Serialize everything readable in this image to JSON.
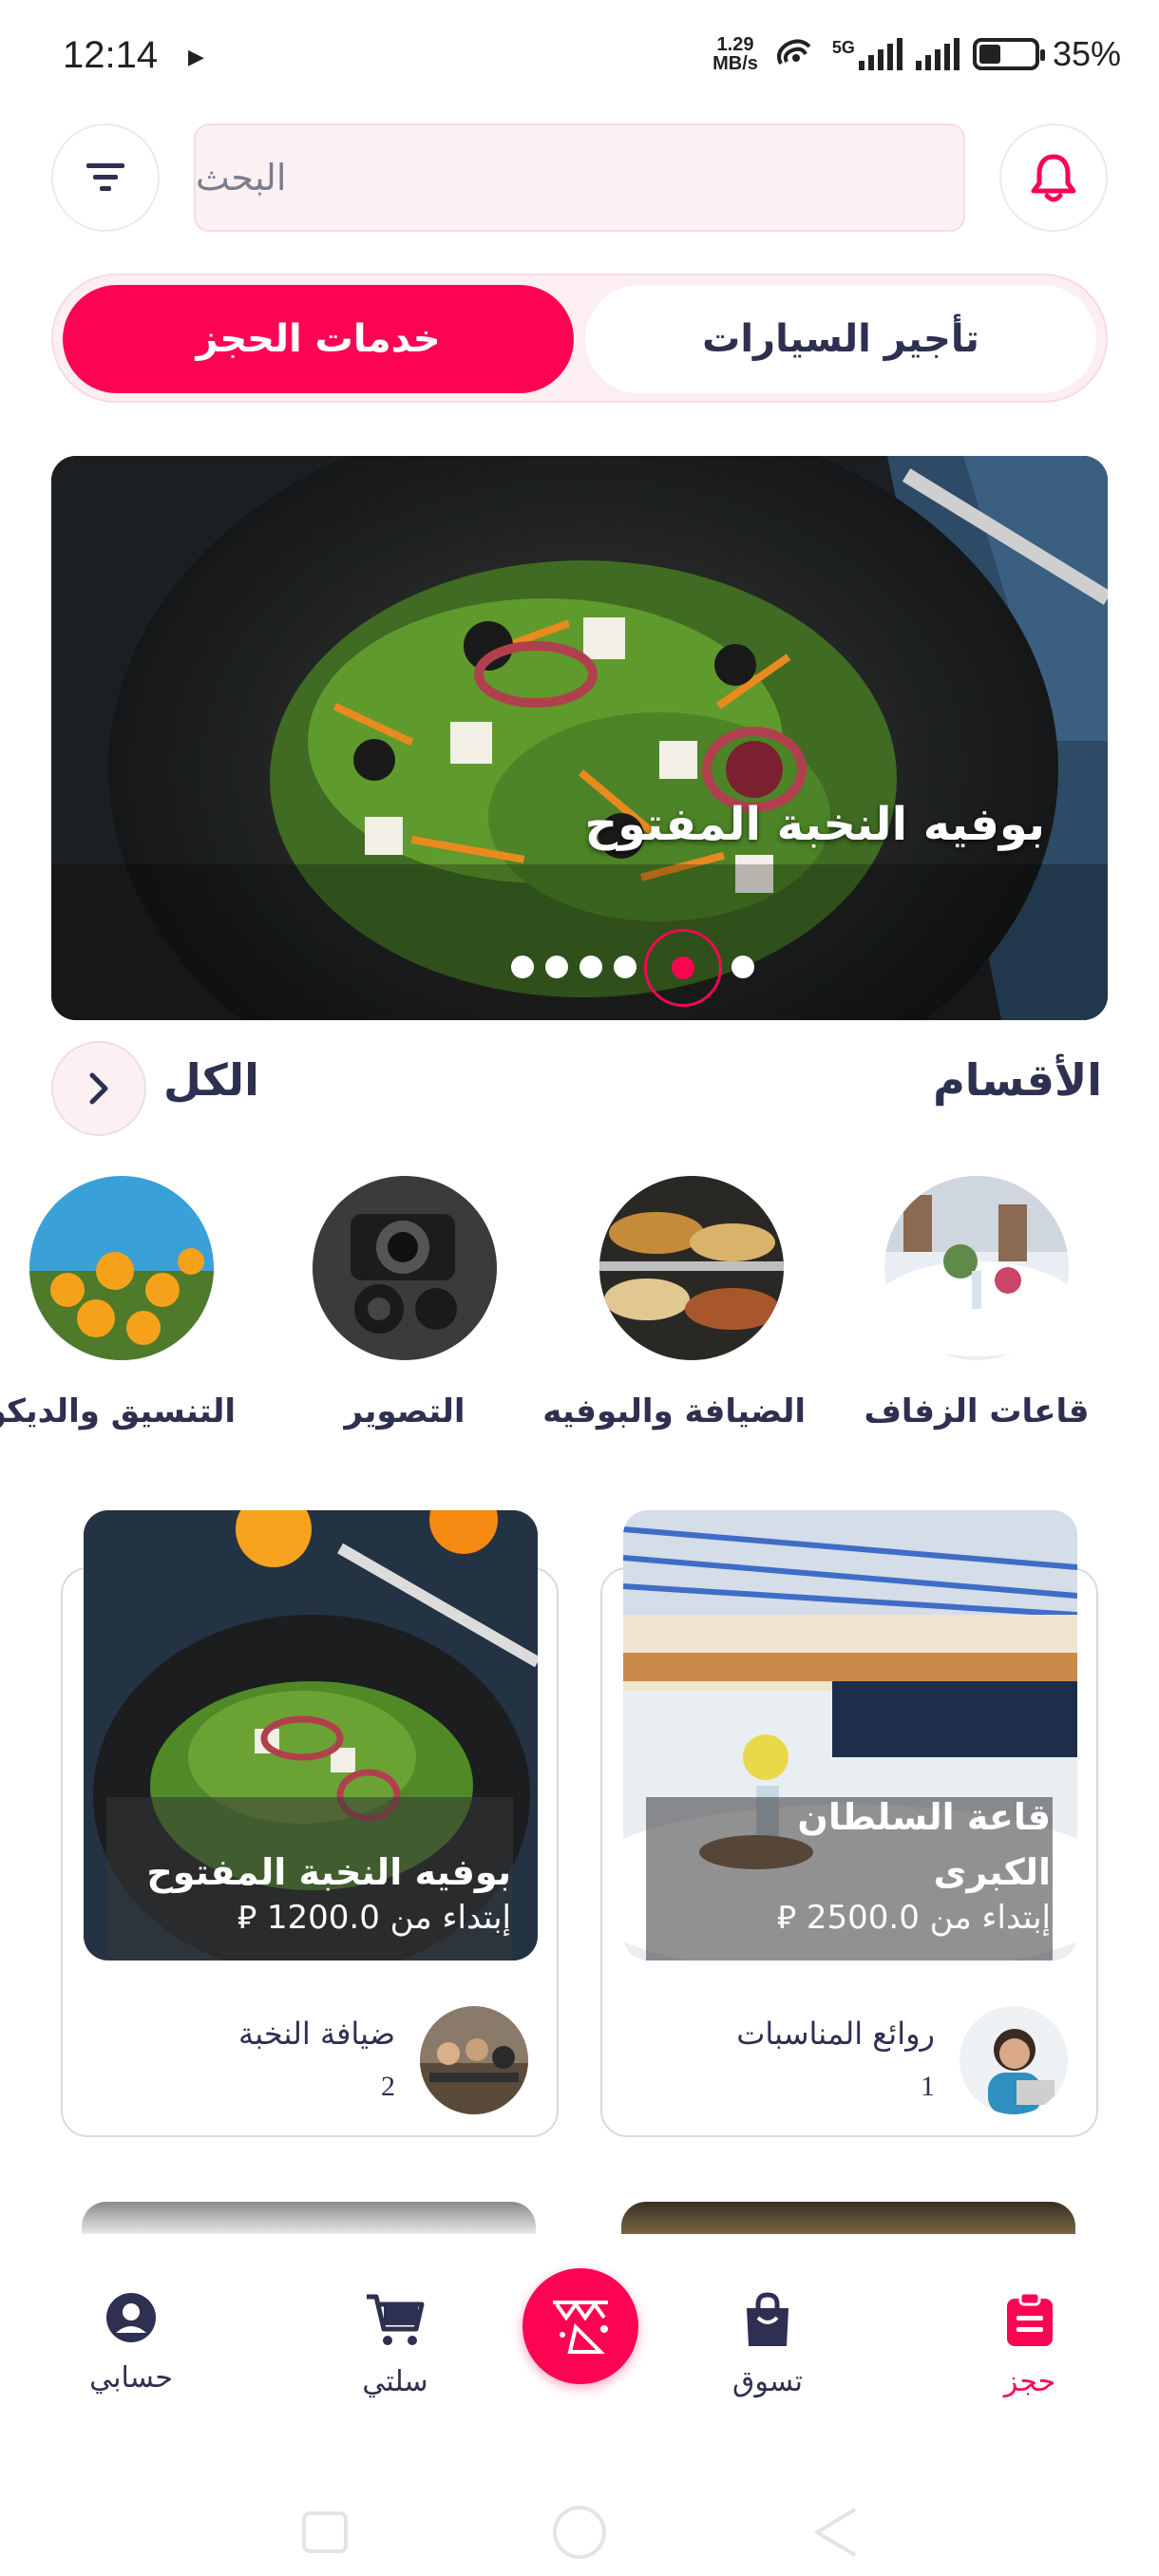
{
  "status_bar": {
    "time": "12:14",
    "speed_value": "1.29",
    "speed_unit": "MB/s",
    "network": "5G",
    "battery": "35%"
  },
  "header": {
    "search_placeholder": "البحث"
  },
  "tabs": [
    {
      "label": "تأجير السيارات",
      "active": false
    },
    {
      "label": "خدمات الحجز",
      "active": true
    }
  ],
  "banner": {
    "title": "بوفيه النخبة المفتوح",
    "slides": 6,
    "active_slide": 5
  },
  "categories_section": {
    "title": "الأقسام",
    "see_all": "الكل"
  },
  "categories": [
    {
      "label": "قاعات الزفاف",
      "icon": "wedding-hall-photo"
    },
    {
      "label": "الضيافة والبوفيه",
      "icon": "buffet-photo"
    },
    {
      "label": "التصوير",
      "icon": "camera-photo"
    },
    {
      "label": "التنسيق والديكور",
      "icon": "flowers-photo"
    }
  ],
  "listings": [
    {
      "title_line1": "قاعة السلطان",
      "title_line2": "الكبرى",
      "price": "إبتداء من 2500.0 ⃁",
      "vendor": "روائع المناسبات",
      "count": "1"
    },
    {
      "title_line1": "بوفيه النخبة المفتوح",
      "price": "إبتداء من 1200.0 ⃁",
      "vendor": "ضيافة النخبة",
      "count": "2"
    }
  ],
  "bottom_nav": [
    {
      "label": "حجز",
      "icon": "clipboard-icon",
      "active": true
    },
    {
      "label": "تسوق",
      "icon": "shopping-bag-icon",
      "active": false
    },
    {
      "label": "",
      "icon": "party-icon",
      "active": false
    },
    {
      "label": "سلتي",
      "icon": "cart-icon",
      "active": false
    },
    {
      "label": "حسابي",
      "icon": "account-icon",
      "active": false
    }
  ],
  "colors": {
    "accent": "#fb0553",
    "text": "#2d3050",
    "search_bg": "#fdf0f3"
  }
}
